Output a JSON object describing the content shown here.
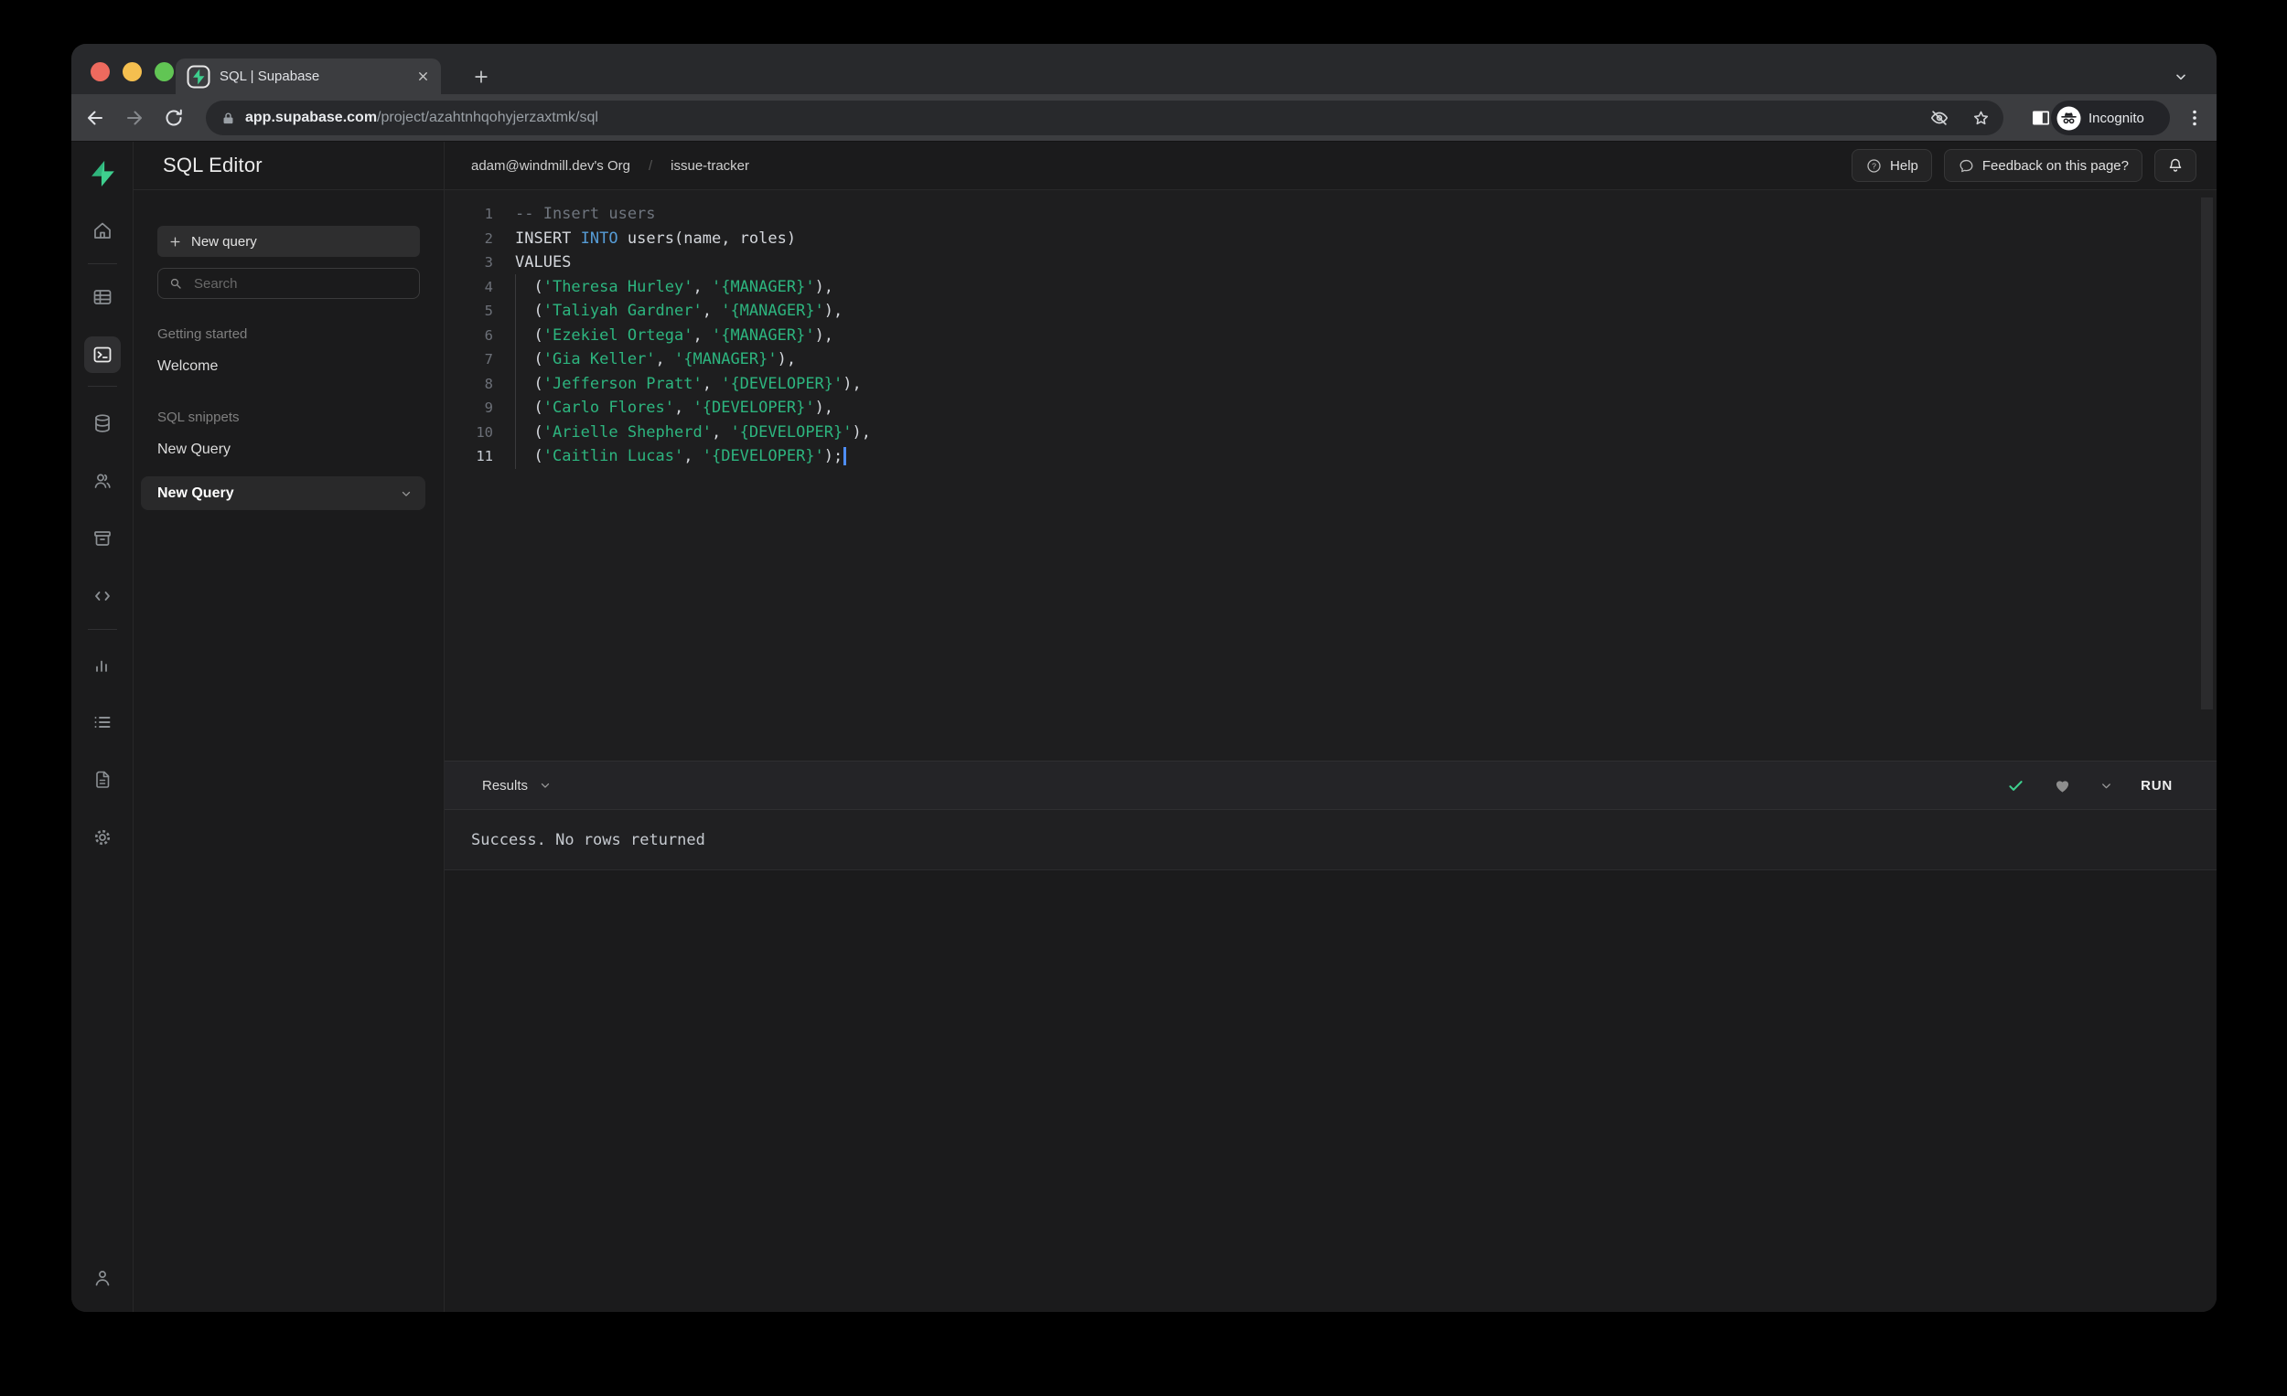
{
  "chrome": {
    "tab_title": "SQL | Supabase",
    "url_host": "app.supabase.com",
    "url_path": "/project/azahtnhqohyjerzaxtmk/sql",
    "incognito_label": "Incognito"
  },
  "rail": {
    "icons": [
      "supabase-logo",
      "home",
      "table-editor",
      "sql-editor",
      "database",
      "authentication",
      "storage",
      "edge-functions",
      "reports",
      "logs",
      "api-docs",
      "project-settings",
      "account"
    ],
    "selected": "sql-editor"
  },
  "panel": {
    "title": "SQL Editor",
    "new_query_label": "New query",
    "search_placeholder": "Search",
    "sections": [
      {
        "label": "Getting started",
        "items": [
          {
            "label": "Welcome",
            "selected": false
          }
        ]
      },
      {
        "label": "SQL snippets",
        "items": [
          {
            "label": "New Query",
            "selected": false
          },
          {
            "label": "New Query",
            "selected": true
          }
        ]
      }
    ]
  },
  "header": {
    "breadcrumb_org": "adam@windmill.dev's Org",
    "breadcrumb_separator": "/",
    "breadcrumb_project": "issue-tracker",
    "help_label": "Help",
    "feedback_label": "Feedback on this page?"
  },
  "editor": {
    "lines": [
      {
        "num": "1",
        "tokens": [
          {
            "text": "-- Insert users",
            "type": "comment"
          }
        ]
      },
      {
        "num": "2",
        "tokens": [
          {
            "text": "INSERT ",
            "type": "plain"
          },
          {
            "text": "INTO",
            "type": "keyword"
          },
          {
            "text": " users(name, roles)",
            "type": "plain"
          }
        ]
      },
      {
        "num": "3",
        "tokens": [
          {
            "text": "VALUES",
            "type": "plain"
          }
        ]
      },
      {
        "num": "4",
        "tokens": [
          {
            "text": "  (",
            "type": "plain"
          },
          {
            "text": "'Theresa Hurley'",
            "type": "string"
          },
          {
            "text": ", ",
            "type": "plain"
          },
          {
            "text": "'{MANAGER}'",
            "type": "string"
          },
          {
            "text": "),",
            "type": "plain"
          }
        ]
      },
      {
        "num": "5",
        "tokens": [
          {
            "text": "  (",
            "type": "plain"
          },
          {
            "text": "'Taliyah Gardner'",
            "type": "string"
          },
          {
            "text": ", ",
            "type": "plain"
          },
          {
            "text": "'{MANAGER}'",
            "type": "string"
          },
          {
            "text": "),",
            "type": "plain"
          }
        ]
      },
      {
        "num": "6",
        "tokens": [
          {
            "text": "  (",
            "type": "plain"
          },
          {
            "text": "'Ezekiel Ortega'",
            "type": "string"
          },
          {
            "text": ", ",
            "type": "plain"
          },
          {
            "text": "'{MANAGER}'",
            "type": "string"
          },
          {
            "text": "),",
            "type": "plain"
          }
        ]
      },
      {
        "num": "7",
        "tokens": [
          {
            "text": "  (",
            "type": "plain"
          },
          {
            "text": "'Gia Keller'",
            "type": "string"
          },
          {
            "text": ", ",
            "type": "plain"
          },
          {
            "text": "'{MANAGER}'",
            "type": "string"
          },
          {
            "text": "),",
            "type": "plain"
          }
        ]
      },
      {
        "num": "8",
        "tokens": [
          {
            "text": "  (",
            "type": "plain"
          },
          {
            "text": "'Jefferson Pratt'",
            "type": "string"
          },
          {
            "text": ", ",
            "type": "plain"
          },
          {
            "text": "'{DEVELOPER}'",
            "type": "string"
          },
          {
            "text": "),",
            "type": "plain"
          }
        ]
      },
      {
        "num": "9",
        "tokens": [
          {
            "text": "  (",
            "type": "plain"
          },
          {
            "text": "'Carlo Flores'",
            "type": "string"
          },
          {
            "text": ", ",
            "type": "plain"
          },
          {
            "text": "'{DEVELOPER}'",
            "type": "string"
          },
          {
            "text": "),",
            "type": "plain"
          }
        ]
      },
      {
        "num": "10",
        "tokens": [
          {
            "text": "  (",
            "type": "plain"
          },
          {
            "text": "'Arielle Shepherd'",
            "type": "string"
          },
          {
            "text": ", ",
            "type": "plain"
          },
          {
            "text": "'{DEVELOPER}'",
            "type": "string"
          },
          {
            "text": "),",
            "type": "plain"
          }
        ]
      },
      {
        "num": "11",
        "active": true,
        "cursor": true,
        "tokens": [
          {
            "text": "  (",
            "type": "plain"
          },
          {
            "text": "'Caitlin Lucas'",
            "type": "string"
          },
          {
            "text": ", ",
            "type": "plain"
          },
          {
            "text": "'{DEVELOPER}'",
            "type": "string"
          },
          {
            "text": ");",
            "type": "plain"
          }
        ]
      }
    ]
  },
  "results": {
    "label": "Results",
    "run_label": "RUN",
    "message": "Success. No rows returned"
  },
  "colors": {
    "accent_green": "#3ECF8E",
    "string_green": "#2DB57F",
    "keyword_blue": "#569CD6",
    "comment_gray": "#6F757E",
    "check_green": "#3ECF8E"
  }
}
